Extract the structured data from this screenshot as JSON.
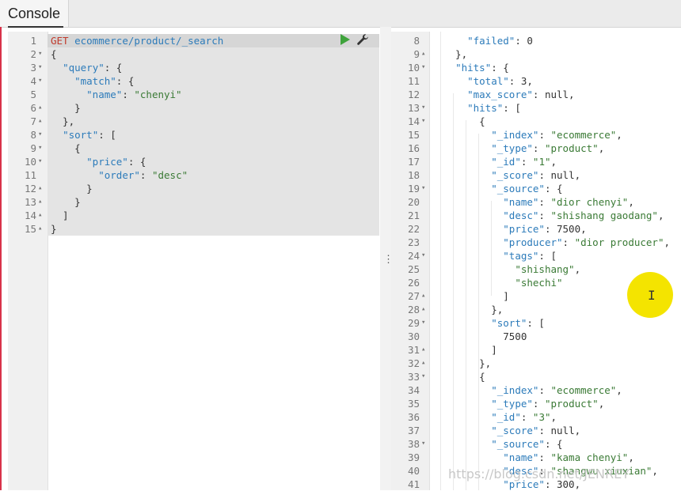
{
  "header": {
    "tab_label": "Console"
  },
  "request": {
    "lines": [
      {
        "n": "1",
        "f": "",
        "method": "GET",
        "url": "ecommerce/product/_search"
      },
      {
        "n": "2",
        "f": "▾",
        "t": "{"
      },
      {
        "n": "3",
        "f": "▾",
        "t": "  \"query\": {"
      },
      {
        "n": "4",
        "f": "▾",
        "t": "    \"match\": {"
      },
      {
        "n": "5",
        "f": "",
        "t": "      \"name\": \"chenyi\""
      },
      {
        "n": "6",
        "f": "▴",
        "t": "    }"
      },
      {
        "n": "7",
        "f": "▴",
        "t": "  },"
      },
      {
        "n": "8",
        "f": "▾",
        "t": "  \"sort\": ["
      },
      {
        "n": "9",
        "f": "▾",
        "t": "    {"
      },
      {
        "n": "10",
        "f": "▾",
        "t": "      \"price\": {"
      },
      {
        "n": "11",
        "f": "",
        "t": "        \"order\": \"desc\""
      },
      {
        "n": "12",
        "f": "▴",
        "t": "      }"
      },
      {
        "n": "13",
        "f": "▴",
        "t": "    }"
      },
      {
        "n": "14",
        "f": "▴",
        "t": "  ]"
      },
      {
        "n": "15",
        "f": "▴",
        "t": "}"
      }
    ]
  },
  "response": {
    "lines": [
      {
        "n": "8",
        "f": "",
        "t": "    \"failed\": 0"
      },
      {
        "n": "9",
        "f": "▴",
        "t": "  },"
      },
      {
        "n": "10",
        "f": "▾",
        "t": "  \"hits\": {"
      },
      {
        "n": "11",
        "f": "",
        "t": "    \"total\": 3,"
      },
      {
        "n": "12",
        "f": "",
        "t": "    \"max_score\": null,"
      },
      {
        "n": "13",
        "f": "▾",
        "t": "    \"hits\": ["
      },
      {
        "n": "14",
        "f": "▾",
        "t": "      {"
      },
      {
        "n": "15",
        "f": "",
        "t": "        \"_index\": \"ecommerce\","
      },
      {
        "n": "16",
        "f": "",
        "t": "        \"_type\": \"product\","
      },
      {
        "n": "17",
        "f": "",
        "t": "        \"_id\": \"1\","
      },
      {
        "n": "18",
        "f": "",
        "t": "        \"_score\": null,"
      },
      {
        "n": "19",
        "f": "▾",
        "t": "        \"_source\": {"
      },
      {
        "n": "20",
        "f": "",
        "t": "          \"name\": \"dior chenyi\","
      },
      {
        "n": "21",
        "f": "",
        "t": "          \"desc\": \"shishang gaodang\","
      },
      {
        "n": "22",
        "f": "",
        "t": "          \"price\": 7500,"
      },
      {
        "n": "23",
        "f": "",
        "t": "          \"producer\": \"dior producer\","
      },
      {
        "n": "24",
        "f": "▾",
        "t": "          \"tags\": ["
      },
      {
        "n": "25",
        "f": "",
        "t": "            \"shishang\","
      },
      {
        "n": "26",
        "f": "",
        "t": "            \"shechi\""
      },
      {
        "n": "27",
        "f": "▴",
        "t": "          ]"
      },
      {
        "n": "28",
        "f": "▴",
        "t": "        },"
      },
      {
        "n": "29",
        "f": "▾",
        "t": "        \"sort\": ["
      },
      {
        "n": "30",
        "f": "",
        "t": "          7500"
      },
      {
        "n": "31",
        "f": "▴",
        "t": "        ]"
      },
      {
        "n": "32",
        "f": "▴",
        "t": "      },"
      },
      {
        "n": "33",
        "f": "▾",
        "t": "      {"
      },
      {
        "n": "34",
        "f": "",
        "t": "        \"_index\": \"ecommerce\","
      },
      {
        "n": "35",
        "f": "",
        "t": "        \"_type\": \"product\","
      },
      {
        "n": "36",
        "f": "",
        "t": "        \"_id\": \"3\","
      },
      {
        "n": "37",
        "f": "",
        "t": "        \"_score\": null,"
      },
      {
        "n": "38",
        "f": "▾",
        "t": "        \"_source\": {"
      },
      {
        "n": "39",
        "f": "",
        "t": "          \"name\": \"kama chenyi\","
      },
      {
        "n": "40",
        "f": "",
        "t": "          \"desc\": \"shangwu xiuxian\","
      },
      {
        "n": "41",
        "f": "",
        "t": "          \"price\": 300,"
      }
    ]
  },
  "icons": {
    "run": "play-icon",
    "settings": "wrench-icon",
    "resize": "vertical-ellipsis-icon"
  },
  "colors": {
    "run_button": "#3fa33c",
    "cursor_highlight": "#f4e400",
    "method": "#c0392b",
    "key": "#2c7bba"
  },
  "watermark": "https://blog.csdn.net/JENREY"
}
